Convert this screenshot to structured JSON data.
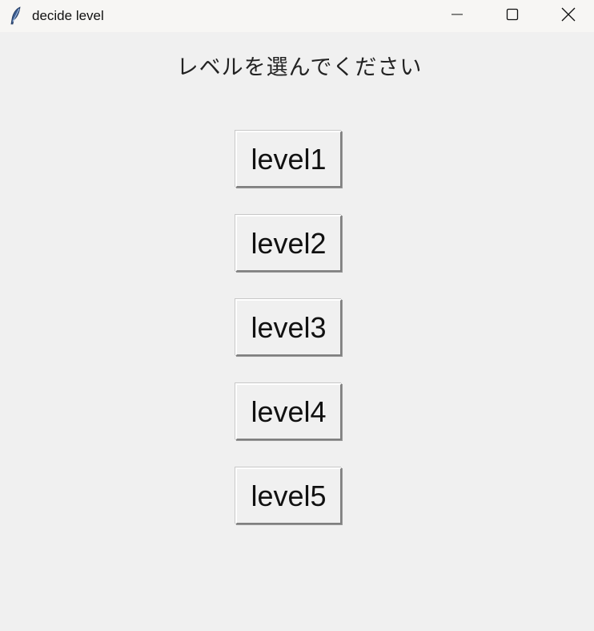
{
  "window": {
    "title": "decide level",
    "icon": "feather-icon",
    "controls": {
      "minimize": "minimize-icon",
      "maximize": "maximize-icon",
      "close": "close-icon"
    }
  },
  "main": {
    "heading": "レベルを選んでください",
    "buttons": [
      {
        "label": "level1"
      },
      {
        "label": "level2"
      },
      {
        "label": "level3"
      },
      {
        "label": "level4"
      },
      {
        "label": "level5"
      }
    ]
  }
}
